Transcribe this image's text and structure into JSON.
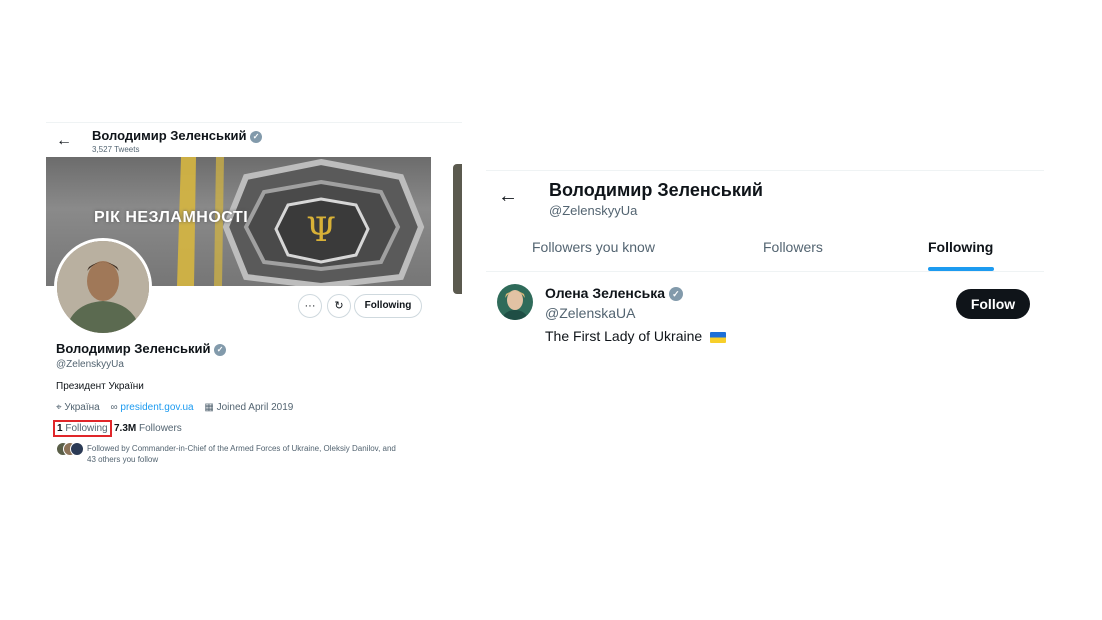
{
  "left_profile": {
    "header_name": "Володимир Зеленський",
    "tweet_count": "3,527 Tweets",
    "banner_text": "РІК НЕЗЛАМНОСТІ",
    "actions": {
      "more": "···",
      "notify": "↻",
      "following_button": "Following"
    },
    "name": "Володимир Зеленський",
    "handle": "@ZelenskyyUa",
    "bio": "Президент України",
    "location": "Україна",
    "website": "president.gov.ua",
    "joined": "Joined April 2019",
    "following_count": "1",
    "following_label": "Following",
    "followers_count": "7.3M",
    "followers_label": "Followers",
    "followed_by_line1": "Followed by Commander-in-Chief of the Armed Forces of Ukraine, Oleksiy Danilov, and",
    "followed_by_line2": "43 others you follow"
  },
  "right_panel": {
    "title": "Володимир Зеленський",
    "handle": "@ZelenskyyUa",
    "tabs": [
      {
        "label": "Followers you know",
        "active": false
      },
      {
        "label": "Followers",
        "active": false
      },
      {
        "label": "Following",
        "active": true
      }
    ],
    "user": {
      "name": "Олена Зеленська",
      "handle": "@ZelenskaUA",
      "bio": "The First Lady of Ukraine",
      "follow_button": "Follow"
    }
  },
  "colors": {
    "accent": "#1d9bf0",
    "highlight_box": "#e0262a",
    "verified_badge": "#829aab",
    "follow_button_bg": "#0f1419"
  }
}
